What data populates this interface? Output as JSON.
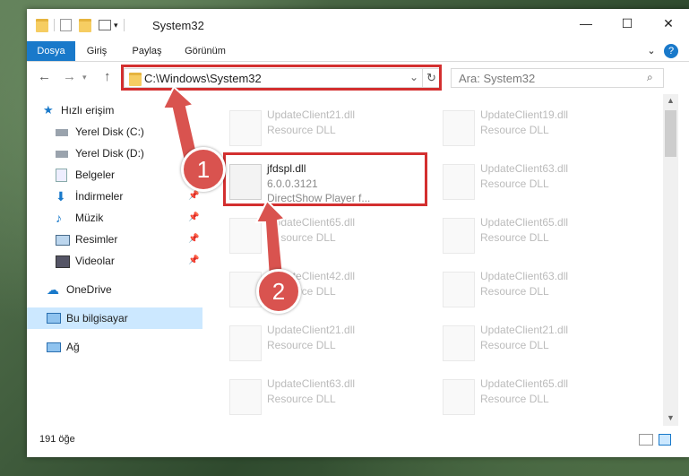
{
  "window": {
    "title": "System32",
    "minimize": "—",
    "maximize": "☐",
    "close": "✕"
  },
  "ribbon": {
    "tabs": [
      "Dosya",
      "Giriş",
      "Paylaş",
      "Görünüm"
    ],
    "help": "?",
    "expand": "⌄"
  },
  "address": {
    "path": "C:\\Windows\\System32",
    "search_placeholder": "Ara: System32"
  },
  "sidebar": {
    "items": [
      {
        "label": "Hızlı erişim",
        "pinned": false
      },
      {
        "label": "Yerel Disk (C:)",
        "pinned": false
      },
      {
        "label": "Yerel Disk (D:)",
        "pinned": false
      },
      {
        "label": "Belgeler",
        "pinned": true
      },
      {
        "label": "İndirmeler",
        "pinned": true
      },
      {
        "label": "Müzik",
        "pinned": true
      },
      {
        "label": "Resimler",
        "pinned": true
      },
      {
        "label": "Videolar",
        "pinned": true
      },
      {
        "label": "OneDrive",
        "pinned": false
      },
      {
        "label": "Bu bilgisayar",
        "pinned": false
      },
      {
        "label": "Ağ",
        "pinned": false
      }
    ]
  },
  "files": {
    "highlighted": {
      "name": "jfdspl.dll",
      "version": "6.0.0.3121",
      "description": "DirectShow Player f..."
    },
    "ghost": [
      {
        "name": "UpdateClient21.dll",
        "type": "Resource DLL"
      },
      {
        "name": "UpdateClient19.dll",
        "type": "Resource DLL"
      },
      {
        "name": "UpdateClient63.dll",
        "type": "Resource DLL"
      },
      {
        "name": "UpdateClient65.dll",
        "type": "Resource DLL"
      },
      {
        "name": "UpdateClient65.dll",
        "type": "Resource DLL"
      },
      {
        "name": "UpdateClient42.dll",
        "type": "Resource DLL"
      },
      {
        "name": "UpdateClient63.dll",
        "type": "Resource DLL"
      },
      {
        "name": "UpdateClient21.dll",
        "type": "Resource DLL"
      },
      {
        "name": "UpdateClient21.dll",
        "type": "Resource DLL"
      },
      {
        "name": "UpdateClient63.dll",
        "type": "Resource DLL"
      },
      {
        "name": "UpdateClient65.dll",
        "type": "Resource DLL"
      }
    ]
  },
  "status": {
    "count": "191 öğe"
  },
  "annotations": {
    "step1": "1",
    "step2": "2",
    "color": "#d32f2f"
  }
}
